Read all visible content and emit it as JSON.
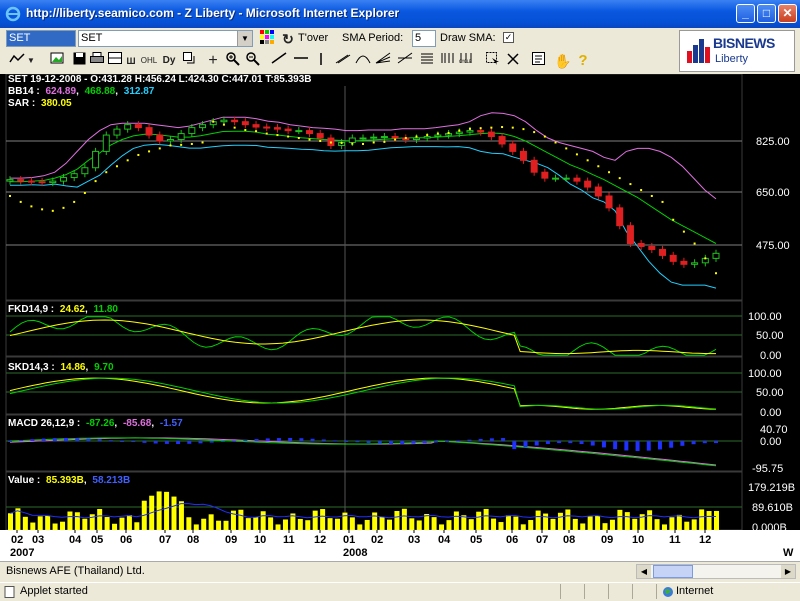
{
  "window": {
    "title": "http://liberty.seamico.com - Z Liberty - Microsoft Internet Explorer",
    "minimize": "_",
    "maximize": "□",
    "close": "✕"
  },
  "toolbar": {
    "symbol_input": "SET",
    "symbol_dropdown": "SET",
    "turnover_label": "T'over",
    "sma_period_label": "SMA Period:",
    "sma_period_value": "5",
    "draw_sma_label": "Draw SMA:",
    "draw_sma_checked": "✓",
    "icons": [
      "line-chart-icon",
      "dropdown-arrow-icon",
      "picture-icon",
      "save-icon",
      "print-icon",
      "split-icon",
      "ohlc-icon",
      "dy-icon",
      "restore-icon",
      "crosshair-icon",
      "zoom-in-icon",
      "zoom-out-icon",
      "trendline-icon",
      "horizontal-line-icon",
      "vertical-line-icon",
      "channel-icon",
      "arc-icon",
      "fan-icon",
      "fibonacci-icon",
      "retracement-icon",
      "cycle-icon",
      "time-zone-icon",
      "select-icon",
      "delete-icon",
      "hand-icon",
      "help-icon"
    ]
  },
  "logo": {
    "name": "BISNEWS",
    "sub": "Liberty"
  },
  "colors": {
    "bb_upper": "#e070e0",
    "bb_mid": "#00d000",
    "bb_lower": "#20d0ff",
    "sar": "#ffff00",
    "up_candle": "#20c020",
    "down_candle": "#e02020",
    "line_yellow": "#ffff00",
    "line_green": "#00d000",
    "macd_hist": "#2030ff",
    "macd_signal": "#e070e0"
  },
  "chart_data": [
    {
      "type": "candlestick",
      "header": "SET 19-12-2008 - O:431.28 H:456.24 L:424.30 C:447.01 T:85.393B",
      "bb_label": "BB14 :",
      "bb_values": [
        "624.89",
        "468.88",
        "312.87"
      ],
      "sar_label": "SAR :",
      "sar_value": "380.05",
      "yticks": [
        "825.00",
        "650.00",
        "475.00"
      ],
      "ylim": [
        300,
        950
      ],
      "ohlc_close": [
        695,
        690,
        688,
        685,
        690,
        702,
        715,
        735,
        790,
        845,
        865,
        880,
        870,
        845,
        825,
        830,
        850,
        870,
        880,
        890,
        895,
        890,
        880,
        872,
        870,
        865,
        860,
        860,
        850,
        835,
        810,
        820,
        835,
        835,
        838,
        840,
        835,
        830,
        835,
        840,
        845,
        850,
        855,
        860,
        855,
        840,
        815,
        790,
        760,
        720,
        700,
        700,
        700,
        690,
        670,
        640,
        600,
        540,
        480,
        470,
        460,
        440,
        420,
        410,
        415,
        430,
        447
      ],
      "upper_band": [
        700,
        700,
        702,
        708,
        720,
        750,
        790,
        830,
        860,
        880,
        885,
        885,
        885,
        880,
        875,
        870,
        875,
        885,
        895,
        905,
        905,
        905,
        900,
        892,
        888,
        880,
        875,
        870,
        868,
        865,
        860,
        860,
        862,
        862,
        862,
        866,
        866,
        866,
        870,
        875,
        880,
        890,
        910,
        920,
        918,
        910,
        890,
        860,
        835,
        820,
        810,
        800,
        790,
        770,
        760,
        790,
        800,
        800,
        790,
        770,
        740,
        700,
        660,
        630
      ],
      "mid_band": [
        688,
        688,
        690,
        692,
        700,
        712,
        730,
        760,
        785,
        812,
        830,
        842,
        848,
        847,
        843,
        838,
        838,
        843,
        850,
        857,
        858,
        858,
        855,
        848,
        845,
        840,
        836,
        833,
        830,
        828,
        826,
        826,
        828,
        830,
        832,
        835,
        836,
        836,
        838,
        840,
        843,
        846,
        850,
        852,
        850,
        840,
        825,
        805,
        785,
        765,
        745,
        730,
        712,
        695,
        675,
        655,
        635,
        610,
        585,
        560,
        540,
        520,
        500,
        480
      ],
      "lower_band": [
        676,
        676,
        678,
        676,
        680,
        674,
        670,
        690,
        710,
        744,
        775,
        800,
        811,
        814,
        811,
        806,
        801,
        801,
        805,
        809,
        811,
        811,
        810,
        804,
        802,
        800,
        797,
        796,
        792,
        791,
        792,
        792,
        794,
        798,
        802,
        804,
        806,
        806,
        806,
        805,
        806,
        802,
        790,
        784,
        782,
        770,
        760,
        750,
        735,
        710,
        680,
        660,
        634,
        620,
        590,
        520,
        470,
        420,
        380,
        350,
        340,
        340,
        340,
        330
      ],
      "sar": [
        640,
        620,
        605,
        595,
        590,
        600,
        620,
        650,
        690,
        720,
        740,
        760,
        778,
        790,
        800,
        810,
        812,
        815,
        820,
        890,
        880,
        870,
        862,
        858,
        850,
        845,
        840,
        835,
        830,
        825,
        820,
        818,
        816,
        815,
        820,
        822,
        830,
        835,
        840,
        845,
        850,
        852,
        860,
        866,
        868,
        870,
        872,
        870,
        865,
        855,
        840,
        820,
        800,
        780,
        760,
        740,
        720,
        700,
        680,
        660,
        640,
        620,
        560,
        520,
        480,
        430,
        380
      ]
    },
    {
      "type": "line",
      "label": "FKD14,9 :",
      "values": [
        "24.62",
        "11.80"
      ],
      "yticks": [
        "100.00",
        "50.00",
        "0.00"
      ],
      "ylim": [
        0,
        100
      ]
    },
    {
      "type": "line",
      "label": "SKD14,3 :",
      "values": [
        "14.86",
        "9.70"
      ],
      "yticks": [
        "100.00",
        "50.00",
        "0.00"
      ],
      "ylim": [
        0,
        100
      ]
    },
    {
      "type": "line",
      "label": "MACD 26,12,9 :",
      "values": [
        "-87.26",
        "-85.68",
        "-1.57"
      ],
      "yticks": [
        "40.70",
        "0.00",
        "-95.75"
      ],
      "ylim": [
        -95.75,
        40.7
      ]
    },
    {
      "type": "bar",
      "label": "Value :",
      "values": [
        "85.393B",
        "58.213B"
      ],
      "yticks": [
        "179.219B",
        "89.610B",
        "0.000B"
      ],
      "ylim": [
        0,
        179.219
      ]
    }
  ],
  "xaxis": {
    "ticks": [
      "02",
      "03",
      "04",
      "05",
      "06",
      "07",
      "08",
      "09",
      "10",
      "11",
      "12",
      "01",
      "02",
      "03",
      "04",
      "05",
      "06",
      "07",
      "08",
      "09",
      "10",
      "11",
      "12"
    ],
    "years": [
      "2007",
      "2008"
    ],
    "period": "W"
  },
  "statusbar": {
    "company": "Bisnews AFE (Thailand) Ltd.",
    "scroll_left": "◀",
    "scroll_right": "▶",
    "applet": "Applet started",
    "zone": "Internet"
  }
}
